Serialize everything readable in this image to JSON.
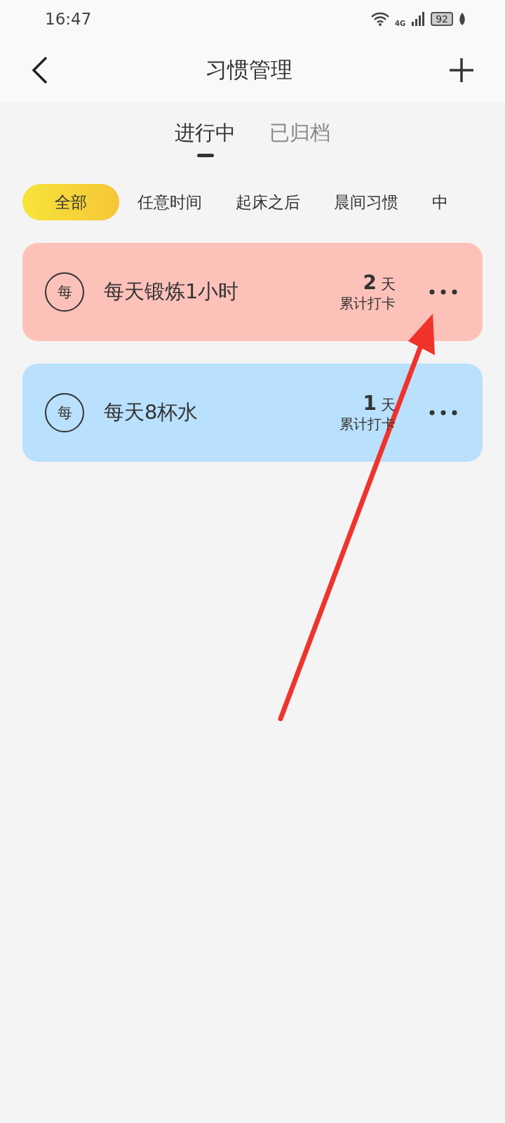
{
  "status_bar": {
    "time": "16:47",
    "network": "4G",
    "battery": "92"
  },
  "header": {
    "title": "习惯管理"
  },
  "tabs": [
    {
      "label": "进行中",
      "selected": true
    },
    {
      "label": "已归档",
      "selected": false
    }
  ],
  "filters": [
    {
      "label": "全部",
      "selected": true
    },
    {
      "label": "任意时间",
      "selected": false
    },
    {
      "label": "起床之后",
      "selected": false
    },
    {
      "label": "晨间习惯",
      "selected": false
    },
    {
      "label": "中",
      "selected": false
    }
  ],
  "habits": [
    {
      "badge": "每",
      "name": "每天锻炼1小时",
      "count": "2",
      "unit": "天",
      "caption": "累计打卡",
      "color": "#fcc1b9"
    },
    {
      "badge": "每",
      "name": "每天8杯水",
      "count": "1",
      "unit": "天",
      "caption": "累计打卡",
      "color": "#b9e0fc"
    }
  ],
  "annotation": {
    "kind": "arrow"
  }
}
